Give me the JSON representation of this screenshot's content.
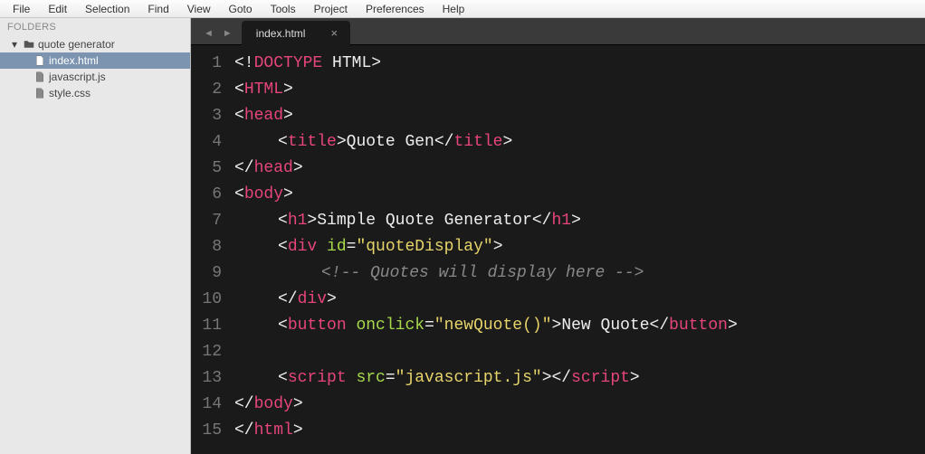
{
  "menu": [
    "File",
    "Edit",
    "Selection",
    "Find",
    "View",
    "Goto",
    "Tools",
    "Project",
    "Preferences",
    "Help"
  ],
  "sidebar": {
    "header": "FOLDERS",
    "root": "quote generator",
    "files": [
      "index.html",
      "javascript.js",
      "style.css"
    ],
    "active": "index.html"
  },
  "tab": {
    "label": "index.html"
  },
  "code": {
    "lines": [
      [
        {
          "t": "<!",
          "c": "p"
        },
        {
          "t": "DOCTYPE",
          "c": "kw"
        },
        {
          "t": " HTML",
          "c": "p"
        },
        {
          "t": ">",
          "c": "p"
        }
      ],
      [
        {
          "t": "<",
          "c": "p"
        },
        {
          "t": "HTML",
          "c": "tag"
        },
        {
          "t": ">",
          "c": "p"
        }
      ],
      [
        {
          "t": "<",
          "c": "p"
        },
        {
          "t": "head",
          "c": "tag"
        },
        {
          "t": ">",
          "c": "p"
        }
      ],
      [
        {
          "t": "",
          "i": 1
        },
        {
          "t": "<",
          "c": "p"
        },
        {
          "t": "title",
          "c": "tag"
        },
        {
          "t": ">",
          "c": "p"
        },
        {
          "t": "Quote Gen",
          "c": "p"
        },
        {
          "t": "</",
          "c": "p"
        },
        {
          "t": "title",
          "c": "tag"
        },
        {
          "t": ">",
          "c": "p"
        }
      ],
      [
        {
          "t": "</",
          "c": "p"
        },
        {
          "t": "head",
          "c": "tag"
        },
        {
          "t": ">",
          "c": "p"
        }
      ],
      [
        {
          "t": "<",
          "c": "p"
        },
        {
          "t": "body",
          "c": "tag"
        },
        {
          "t": ">",
          "c": "p"
        }
      ],
      [
        {
          "t": "",
          "i": 1
        },
        {
          "t": "<",
          "c": "p"
        },
        {
          "t": "h1",
          "c": "tag"
        },
        {
          "t": ">",
          "c": "p"
        },
        {
          "t": "Simple Quote Generator",
          "c": "p"
        },
        {
          "t": "</",
          "c": "p"
        },
        {
          "t": "h1",
          "c": "tag"
        },
        {
          "t": ">",
          "c": "p"
        }
      ],
      [
        {
          "t": "",
          "i": 1
        },
        {
          "t": "<",
          "c": "p"
        },
        {
          "t": "div",
          "c": "tag"
        },
        {
          "t": " ",
          "c": "p"
        },
        {
          "t": "id",
          "c": "attr"
        },
        {
          "t": "=",
          "c": "p"
        },
        {
          "t": "\"quoteDisplay\"",
          "c": "str"
        },
        {
          "t": ">",
          "c": "p"
        }
      ],
      [
        {
          "t": "",
          "i": 2
        },
        {
          "t": "<!-- Quotes will display here -->",
          "c": "comm"
        }
      ],
      [
        {
          "t": "",
          "i": 1
        },
        {
          "t": "</",
          "c": "p"
        },
        {
          "t": "div",
          "c": "tag"
        },
        {
          "t": ">",
          "c": "p"
        }
      ],
      [
        {
          "t": "",
          "i": 1
        },
        {
          "t": "<",
          "c": "p"
        },
        {
          "t": "button",
          "c": "tag"
        },
        {
          "t": " ",
          "c": "p"
        },
        {
          "t": "onclick",
          "c": "attr"
        },
        {
          "t": "=",
          "c": "p"
        },
        {
          "t": "\"newQuote()\"",
          "c": "str"
        },
        {
          "t": ">",
          "c": "p"
        },
        {
          "t": "New Quote",
          "c": "p"
        },
        {
          "t": "</",
          "c": "p"
        },
        {
          "t": "button",
          "c": "tag"
        },
        {
          "t": ">",
          "c": "p"
        }
      ],
      [],
      [
        {
          "t": "",
          "i": 1
        },
        {
          "t": "<",
          "c": "p"
        },
        {
          "t": "script",
          "c": "tag"
        },
        {
          "t": " ",
          "c": "p"
        },
        {
          "t": "src",
          "c": "attr"
        },
        {
          "t": "=",
          "c": "p"
        },
        {
          "t": "\"javascript.js\"",
          "c": "str"
        },
        {
          "t": ">",
          "c": "p"
        },
        {
          "t": "</",
          "c": "p"
        },
        {
          "t": "script",
          "c": "tag"
        },
        {
          "t": ">",
          "c": "p"
        }
      ],
      [
        {
          "t": "</",
          "c": "p"
        },
        {
          "t": "body",
          "c": "tag"
        },
        {
          "t": ">",
          "c": "p"
        }
      ],
      [
        {
          "t": "</",
          "c": "p"
        },
        {
          "t": "html",
          "c": "tag"
        },
        {
          "t": ">",
          "c": "p"
        }
      ]
    ]
  }
}
